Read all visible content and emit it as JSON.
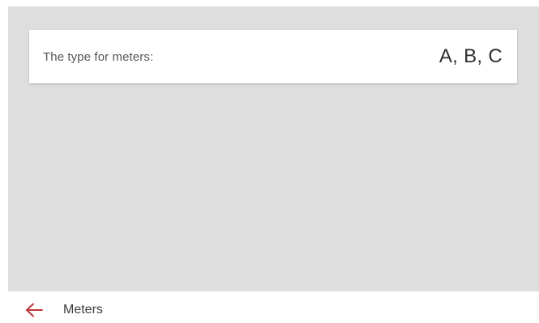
{
  "card": {
    "label": "The type for meters:",
    "value": "A, B, C"
  },
  "footer": {
    "back_icon": "arrow-left-icon",
    "title": "Meters",
    "accent_color": "#c0363c"
  }
}
